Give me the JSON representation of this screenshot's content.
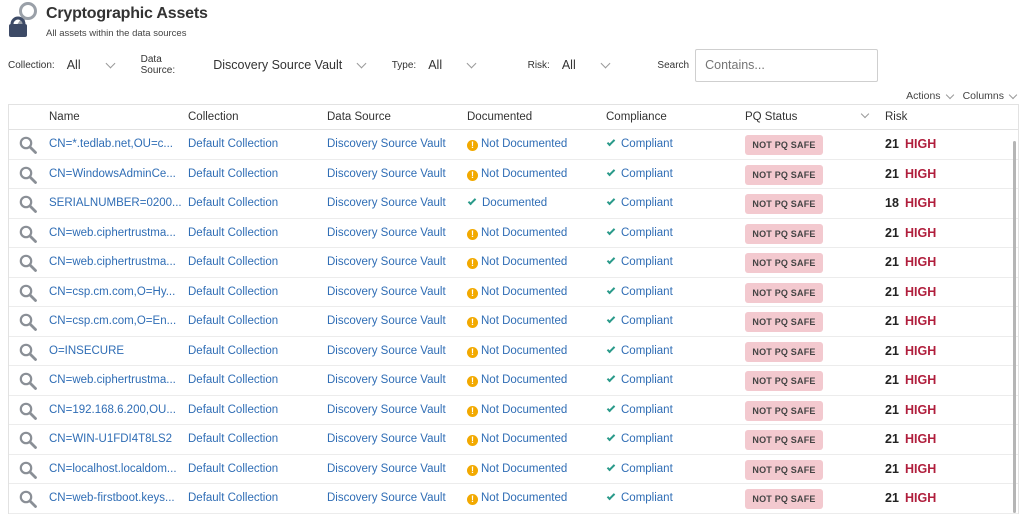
{
  "header": {
    "title": "Cryptographic Assets",
    "subtitle": "All assets within the data sources",
    "icon": "lock-key-icon"
  },
  "filters": {
    "collection_label": "Collection:",
    "collection_value": "All",
    "datasource_label": "Data Source:",
    "datasource_value": "Discovery Source Vault",
    "type_label": "Type:",
    "type_value": "All",
    "risk_label": "Risk:",
    "risk_value": "All",
    "search_label": "Search",
    "search_placeholder": "Contains..."
  },
  "toolbar": {
    "actions_label": "Actions",
    "columns_label": "Columns"
  },
  "table": {
    "columns": [
      "Name",
      "Collection",
      "Data Source",
      "Documented",
      "Compliance",
      "PQ Status",
      "Risk"
    ],
    "rows": [
      {
        "name": "CN=*.tedlab.net,OU=c...",
        "collection": "Default Collection",
        "source": "Discovery Source Vault",
        "documented": "Not Documented",
        "doc_ok": false,
        "compliance": "Compliant",
        "pq": "NOT PQ SAFE",
        "risk_score": "21",
        "risk_level": "HIGH"
      },
      {
        "name": "CN=WindowsAdminCe...",
        "collection": "Default Collection",
        "source": "Discovery Source Vault",
        "documented": "Not Documented",
        "doc_ok": false,
        "compliance": "Compliant",
        "pq": "NOT PQ SAFE",
        "risk_score": "21",
        "risk_level": "HIGH"
      },
      {
        "name": "SERIALNUMBER=0200...",
        "collection": "Default Collection",
        "source": "Discovery Source Vault",
        "documented": "Documented",
        "doc_ok": true,
        "compliance": "Compliant",
        "pq": "NOT PQ SAFE",
        "risk_score": "18",
        "risk_level": "HIGH"
      },
      {
        "name": "CN=web.ciphertrustma...",
        "collection": "Default Collection",
        "source": "Discovery Source Vault",
        "documented": "Not Documented",
        "doc_ok": false,
        "compliance": "Compliant",
        "pq": "NOT PQ SAFE",
        "risk_score": "21",
        "risk_level": "HIGH"
      },
      {
        "name": "CN=web.ciphertrustma...",
        "collection": "Default Collection",
        "source": "Discovery Source Vault",
        "documented": "Not Documented",
        "doc_ok": false,
        "compliance": "Compliant",
        "pq": "NOT PQ SAFE",
        "risk_score": "21",
        "risk_level": "HIGH"
      },
      {
        "name": "CN=csp.cm.com,O=Hy...",
        "collection": "Default Collection",
        "source": "Discovery Source Vault",
        "documented": "Not Documented",
        "doc_ok": false,
        "compliance": "Compliant",
        "pq": "NOT PQ SAFE",
        "risk_score": "21",
        "risk_level": "HIGH"
      },
      {
        "name": "CN=csp.cm.com,O=En...",
        "collection": "Default Collection",
        "source": "Discovery Source Vault",
        "documented": "Not Documented",
        "doc_ok": false,
        "compliance": "Compliant",
        "pq": "NOT PQ SAFE",
        "risk_score": "21",
        "risk_level": "HIGH"
      },
      {
        "name": "O=INSECURE",
        "collection": "Default Collection",
        "source": "Discovery Source Vault",
        "documented": "Not Documented",
        "doc_ok": false,
        "compliance": "Compliant",
        "pq": "NOT PQ SAFE",
        "risk_score": "21",
        "risk_level": "HIGH"
      },
      {
        "name": "CN=web.ciphertrustma...",
        "collection": "Default Collection",
        "source": "Discovery Source Vault",
        "documented": "Not Documented",
        "doc_ok": false,
        "compliance": "Compliant",
        "pq": "NOT PQ SAFE",
        "risk_score": "21",
        "risk_level": "HIGH"
      },
      {
        "name": "CN=192.168.6.200,OU...",
        "collection": "Default Collection",
        "source": "Discovery Source Vault",
        "documented": "Not Documented",
        "doc_ok": false,
        "compliance": "Compliant",
        "pq": "NOT PQ SAFE",
        "risk_score": "21",
        "risk_level": "HIGH"
      },
      {
        "name": "CN=WIN-U1FDI4T8LS2",
        "collection": "Default Collection",
        "source": "Discovery Source Vault",
        "documented": "Not Documented",
        "doc_ok": false,
        "compliance": "Compliant",
        "pq": "NOT PQ SAFE",
        "risk_score": "21",
        "risk_level": "HIGH"
      },
      {
        "name": "CN=localhost.localdom...",
        "collection": "Default Collection",
        "source": "Discovery Source Vault",
        "documented": "Not Documented",
        "doc_ok": false,
        "compliance": "Compliant",
        "pq": "NOT PQ SAFE",
        "risk_score": "21",
        "risk_level": "HIGH"
      },
      {
        "name": "CN=web-firstboot.keys...",
        "collection": "Default Collection",
        "source": "Discovery Source Vault",
        "documented": "Not Documented",
        "doc_ok": false,
        "compliance": "Compliant",
        "pq": "NOT PQ SAFE",
        "risk_score": "21",
        "risk_level": "HIGH"
      }
    ]
  },
  "colors": {
    "link": "#2f6db5",
    "risk_high": "#b01e3c",
    "pq_badge": "#f3c9cf",
    "check": "#2a9a8a",
    "warn": "#f2a900"
  }
}
